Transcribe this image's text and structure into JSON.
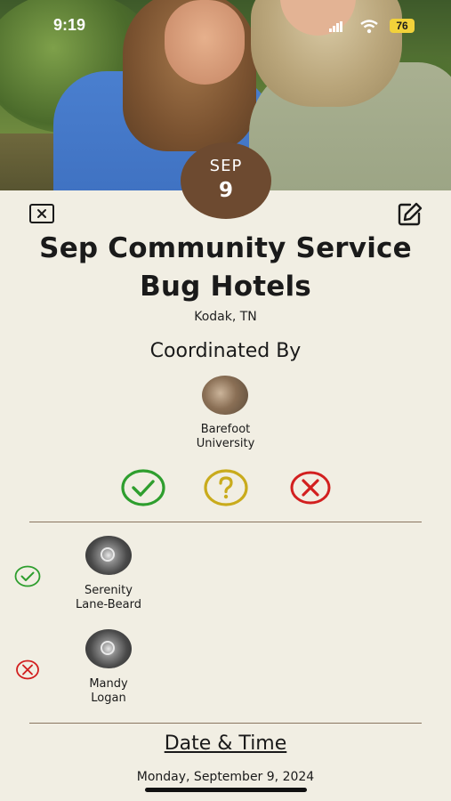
{
  "status_bar": {
    "time": "9:19",
    "battery": "76"
  },
  "event": {
    "date_month": "SEP",
    "date_day": "9",
    "title_line1": "Sep Community Service",
    "title_line2": "Bug Hotels",
    "location": "Kodak, TN"
  },
  "coordinator": {
    "heading": "Coordinated By",
    "name_line1": "Barefoot",
    "name_line2": "University"
  },
  "attendees": [
    {
      "name_line1": "Serenity",
      "name_line2": "Lane-Beard",
      "status": "going"
    },
    {
      "name_line1": "Mandy",
      "name_line2": "Logan",
      "status": "not-going"
    }
  ],
  "date_time": {
    "heading": "Date & Time",
    "value": "Monday, September 9, 2024"
  },
  "colors": {
    "badge": "#6d4a30",
    "yes": "#2e9e2e",
    "maybe": "#c9ab1c",
    "no": "#d21f1f",
    "background": "#f1eee3"
  },
  "icons": {
    "close": "close-icon",
    "edit": "edit-icon",
    "yes": "check-circle-icon",
    "maybe": "question-circle-icon",
    "no": "x-circle-icon"
  }
}
